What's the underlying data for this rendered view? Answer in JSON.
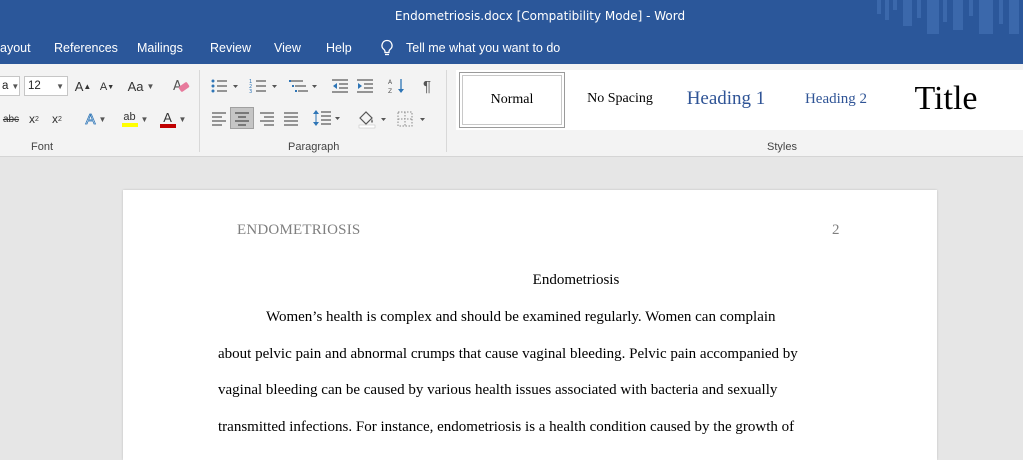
{
  "window": {
    "title": "Endometriosis.docx [Compatibility Mode]  -  Word"
  },
  "menu": {
    "tabs": [
      "ayout",
      "References",
      "Mailings",
      "Review",
      "View",
      "Help"
    ],
    "tell_me": "Tell me what you want to do"
  },
  "ribbon": {
    "font": {
      "name_value": "a",
      "size_value": "12",
      "label": "Font",
      "case_label": "Aa",
      "grow_label": "A",
      "shrink_label": "A",
      "strike_label": "abc",
      "subscript_label": "x",
      "superscript_label": "x",
      "effects_label": "A",
      "highlight_label": "ab",
      "color_label": "A",
      "highlight_color": "#ffff00",
      "font_color": "#c00000"
    },
    "paragraph": {
      "label": "Paragraph",
      "marks_label": "¶"
    },
    "styles": {
      "label": "Styles",
      "items": [
        {
          "label": "Normal",
          "selected": true
        },
        {
          "label": "No Spacing",
          "selected": false
        },
        {
          "label": "Heading 1",
          "selected": false
        },
        {
          "label": "Heading 2",
          "selected": false
        },
        {
          "label": "Title",
          "selected": false
        }
      ]
    }
  },
  "document": {
    "header_left": "ENDOMETRIOSIS",
    "page_number": "2",
    "title": "Endometriosis",
    "lines": [
      "Women’s health is complex and should be examined regularly. Women can complain",
      "about pelvic pain and abnormal crumps that cause vaginal bleeding. Pelvic pain accompanied by",
      "vaginal bleeding can be caused by various health issues associated with bacteria and sexually",
      "transmitted infections. For instance, endometriosis is a health condition caused by the growth of"
    ]
  },
  "colors": {
    "brand_blue": "#2b579a",
    "heading_blue": "#2f5496"
  }
}
